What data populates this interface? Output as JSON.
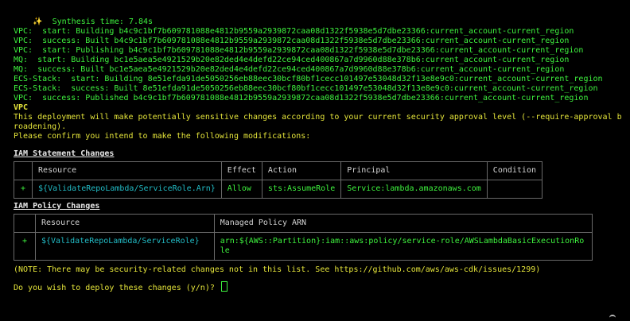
{
  "synthesis": {
    "icon": "sparkles-icon",
    "glyph": "✨",
    "text": "Synthesis time: 7.84s"
  },
  "log_lines": [
    "VPC:  start: Building b4c9c1bf7b609781088e4812b9559a2939872caa08d1322f5938e5d7dbe23366:current_account-current_region",
    "VPC:  success: Built b4c9c1bf7b609781088e4812b9559a2939872caa08d1322f5938e5d7dbe23366:current_account-current_region",
    "VPC:  start: Publishing b4c9c1bf7b609781088e4812b9559a2939872caa08d1322f5938e5d7dbe23366:current_account-current_region",
    "MQ:  start: Building bc1e5aea5e4921529b20e82ded4e4defd22ce94ced400867a7d9960d88e378b6:current_account-current_region",
    "MQ:  success: Built bc1e5aea5e4921529b20e82ded4e4defd22ce94ced400867a7d9960d88e378b6:current_account-current_region",
    "ECS-Stack:  start: Building 8e51efda91de5050256eb88eec30bcf80bf1cecc101497e53048d32f13e8e9c0:current_account-current_region",
    "ECS-Stack:  success: Built 8e51efda91de5050256eb88eec30bcf80bf1cecc101497e53048d32f13e8e9c0:current_account-current_region",
    "VPC:  success: Published b4c9c1bf7b609781088e4812b9559a2939872caa08d1322f5938e5d7dbe23366:current_account-current_region"
  ],
  "stack_name": "VPC",
  "warning_lines": {
    "line1": "This deployment will make potentially sensitive changes according to your current security approval level (--require-approval broadening).",
    "line2": "Please confirm you intend to make the following modifications:"
  },
  "iam_statement": {
    "title": "IAM Statement Changes",
    "headers": [
      "",
      "Resource",
      "Effect",
      "Action",
      "Principal",
      "Condition"
    ],
    "rows": [
      [
        "+",
        "${ValidateRepoLambda/ServiceRole.Arn}",
        "Allow",
        "sts:AssumeRole",
        "Service:lambda.amazonaws.com",
        ""
      ]
    ]
  },
  "iam_policy": {
    "title": "IAM Policy Changes",
    "headers": [
      "",
      "Resource",
      "Managed Policy ARN"
    ],
    "rows": [
      [
        "+",
        "${ValidateRepoLambda/ServiceRole}",
        "arn:${AWS::Partition}:iam::aws:policy/service-role/AWSLambdaBasicExecutionRole"
      ]
    ]
  },
  "note": "(NOTE: There may be security-related changes not in this list. See https://github.com/aws/aws-cdk/issues/1299)",
  "prompt": "Do you wish to deploy these changes (y/n)?",
  "colors": {
    "background": "#000000",
    "green": "#3ef23e",
    "yellow": "#e4e43a",
    "cyan": "#22bcc6",
    "border": "#6a6a6a"
  }
}
